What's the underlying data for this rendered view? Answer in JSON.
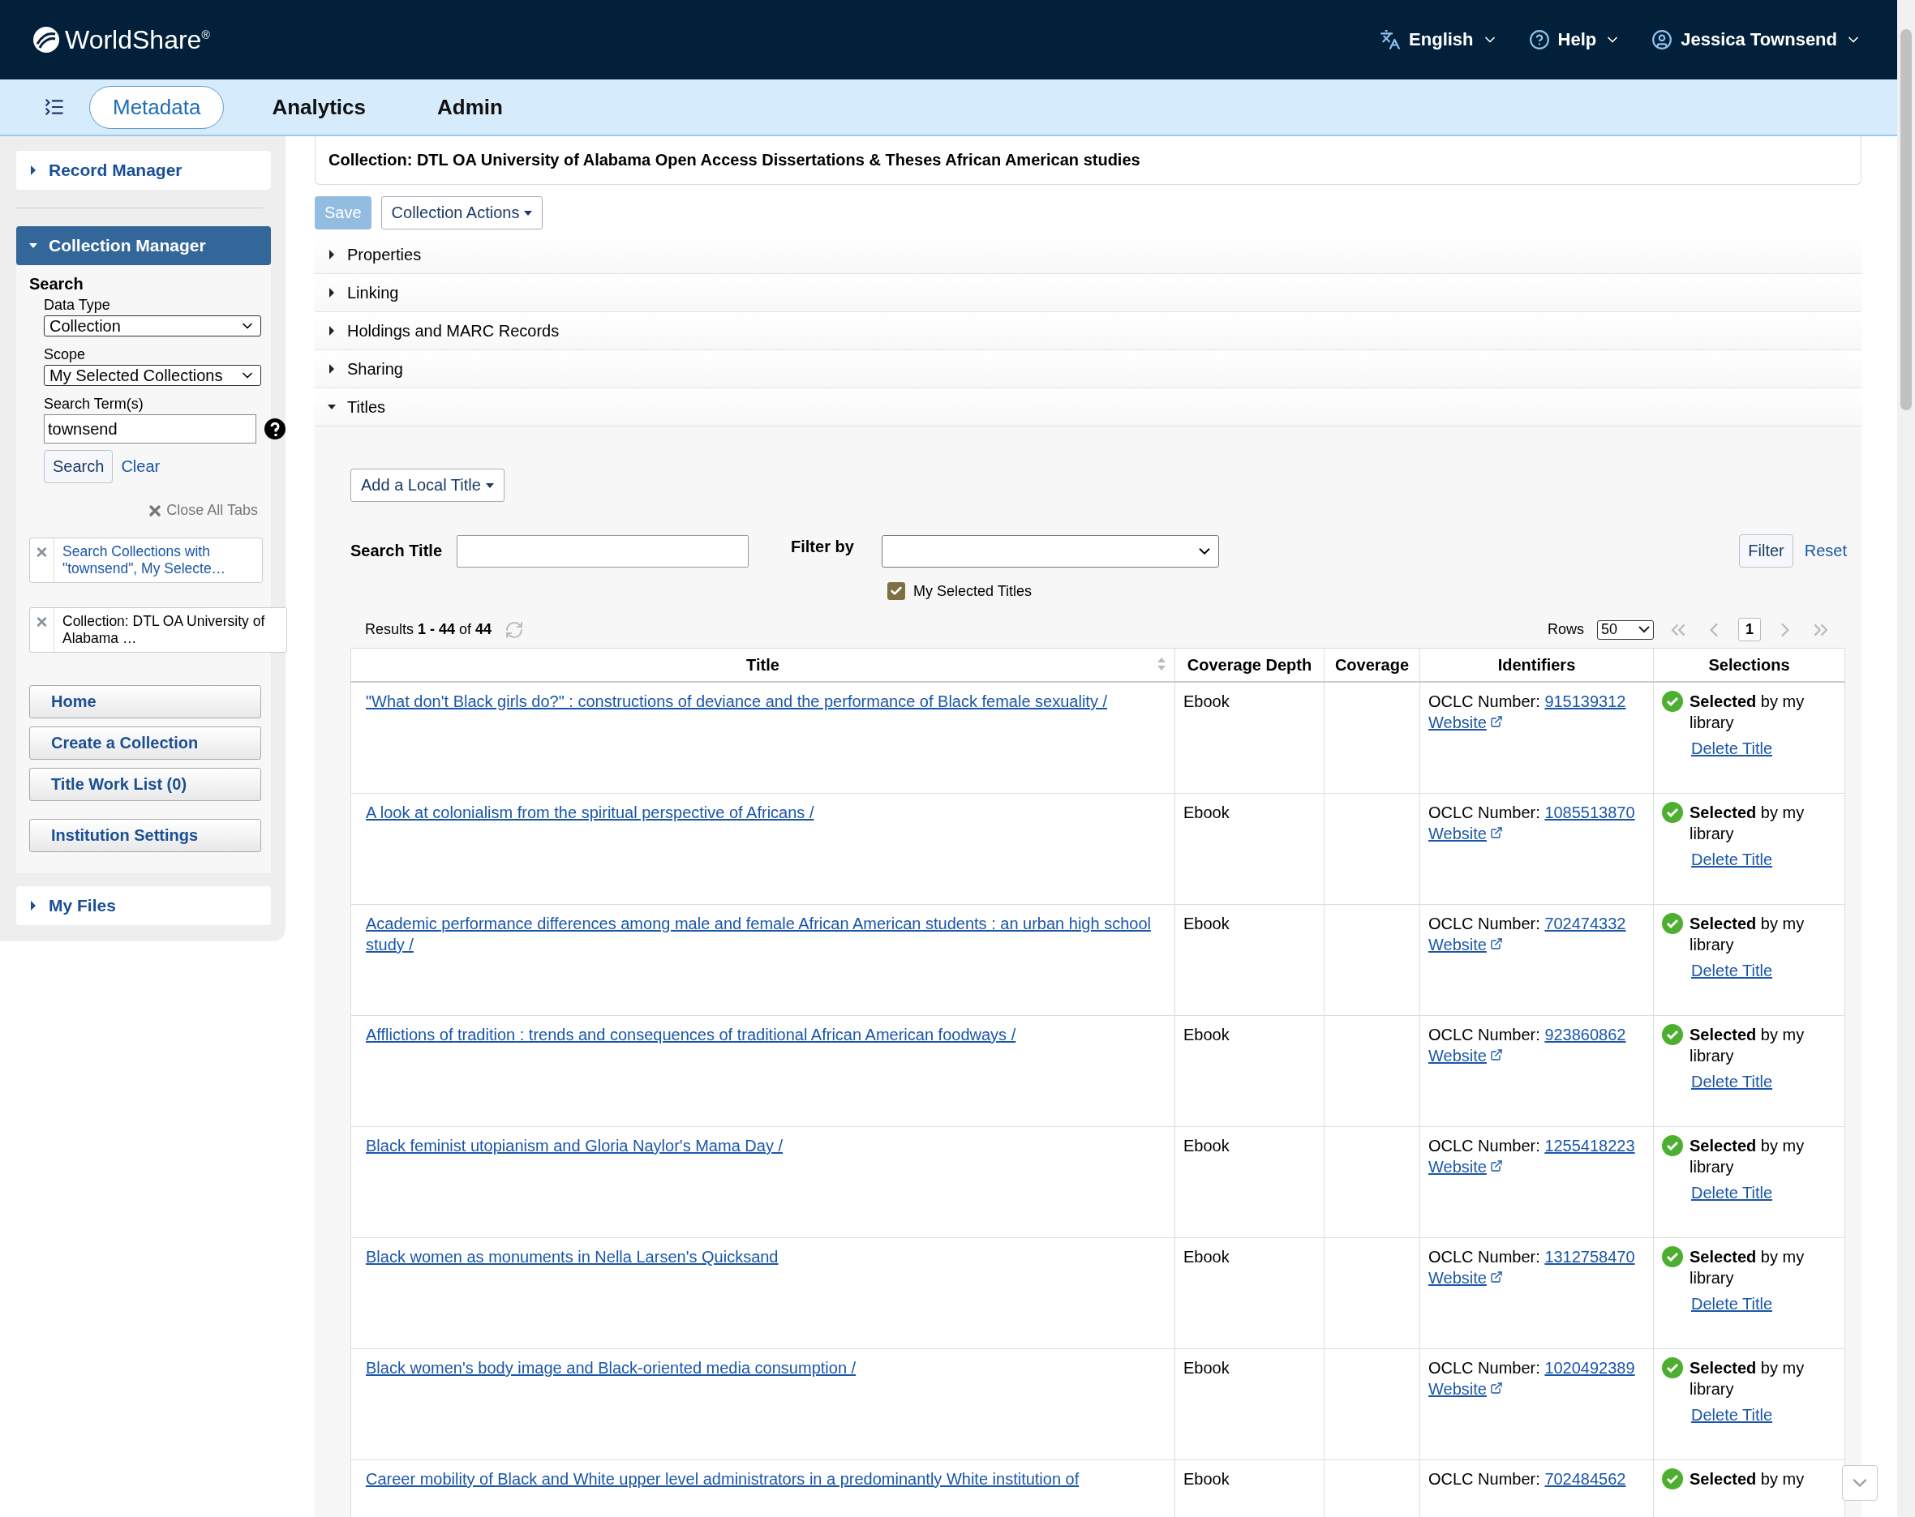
{
  "header": {
    "logo": "WorldShare$^{®}$",
    "language": "English",
    "help": "Help",
    "user": "Jessica Townsend"
  },
  "nav": {
    "tabs": [
      {
        "label": "Metadata",
        "selected": true
      },
      {
        "label": "Analytics",
        "selected": false
      },
      {
        "label": "Admin",
        "selected": false
      }
    ]
  },
  "sidebar": {
    "panels": [
      {
        "title": "Record Manager",
        "expanded": false
      },
      {
        "title": "Collection Manager",
        "expanded": true
      },
      {
        "title": "My Files",
        "expanded": false
      }
    ],
    "search": {
      "heading": "Search",
      "data_type_label": "Data Type",
      "data_type": "Collection",
      "scope_label": "Scope",
      "scope": "My Selected Collections",
      "term_label": "Search Term(s)",
      "term": "townsend",
      "search_button": "Search",
      "clear_link": "Clear"
    },
    "close_all": "Close All Tabs",
    "open_tabs": [
      {
        "label": "Search Collections with \"townsend\", My Selecte…",
        "selected": false
      },
      {
        "label": "Collection: DTL OA University of Alabama …",
        "selected": true
      }
    ],
    "buttons": [
      "Home",
      "Create a Collection",
      "Title Work List (0)",
      "Institution Settings"
    ]
  },
  "main": {
    "collection_title": "Collection: DTL OA University of Alabama Open Access Dissertations & Theses African American studies",
    "save": {
      "label": "Save",
      "disabled": true
    },
    "actions": "Collection Actions",
    "sections": [
      {
        "label": "Properties",
        "expanded": false
      },
      {
        "label": "Linking",
        "expanded": false
      },
      {
        "label": "Holdings and MARC Records",
        "expanded": false
      },
      {
        "label": "Sharing",
        "expanded": false
      },
      {
        "label": "Titles",
        "expanded": true
      }
    ],
    "add_title": "Add a Local Title",
    "search_title_label": "Search Title",
    "filter_by_label": "Filter by",
    "filter_button": "Filter",
    "reset_link": "Reset",
    "my_selected": {
      "label": "My Selected Titles",
      "checked": true
    },
    "results": "Results **1 - 44** of **44**",
    "rows_label": "Rows",
    "rows_value": "50",
    "page": "1",
    "columns": [
      "Title",
      "Coverage Depth",
      "Coverage",
      "Identifiers",
      "Selections"
    ],
    "rows": [
      {
        "title": "\"What don't Black girls do?\" : constructions of deviance and the performance of Black female sexuality /",
        "depth": "Ebook",
        "id_label": "OCLC Number:",
        "oclc": "915139312",
        "website": "Website",
        "selection": "**Selected** by my library",
        "delete": "Delete Title"
      },
      {
        "title": "A look at colonialism from the spiritual perspective of Africans /",
        "depth": "Ebook",
        "id_label": "OCLC Number:",
        "oclc": "1085513870",
        "website": "Website",
        "selection": "**Selected** by my library",
        "delete": "Delete Title"
      },
      {
        "title": "Academic performance differences among male and female African American students : an urban high school study /",
        "depth": "Ebook",
        "id_label": "OCLC Number:",
        "oclc": "702474332",
        "website": "Website",
        "selection": "**Selected** by my library",
        "delete": "Delete Title"
      },
      {
        "title": "Afflictions of tradition : trends and consequences of traditional African American foodways /",
        "depth": "Ebook",
        "id_label": "OCLC Number:",
        "oclc": "923860862",
        "website": "Website",
        "selection": "**Selected** by my library",
        "delete": "Delete Title"
      },
      {
        "title": "Black feminist utopianism and Gloria Naylor's Mama Day /",
        "depth": "Ebook",
        "id_label": "OCLC Number:",
        "oclc": "1255418223",
        "website": "Website",
        "selection": "**Selected** by my library",
        "delete": "Delete Title"
      },
      {
        "title": "Black women as monuments in Nella Larsen's Quicksand",
        "depth": "Ebook",
        "id_label": "OCLC Number:",
        "oclc": "1312758470",
        "website": "Website",
        "selection": "**Selected** by my library",
        "delete": "Delete Title"
      },
      {
        "title": "Black women's body image and Black-oriented media consumption /",
        "depth": "Ebook",
        "id_label": "OCLC Number:",
        "oclc": "1020492389",
        "website": "Website",
        "selection": "**Selected** by my library",
        "delete": "Delete Title"
      },
      {
        "title": "Career mobility of Black and White upper level administrators in a predominantly White institution of",
        "depth": "Ebook",
        "id_label": "OCLC Number:",
        "oclc": "702484562",
        "selection": "**Selected** by my"
      }
    ]
  }
}
